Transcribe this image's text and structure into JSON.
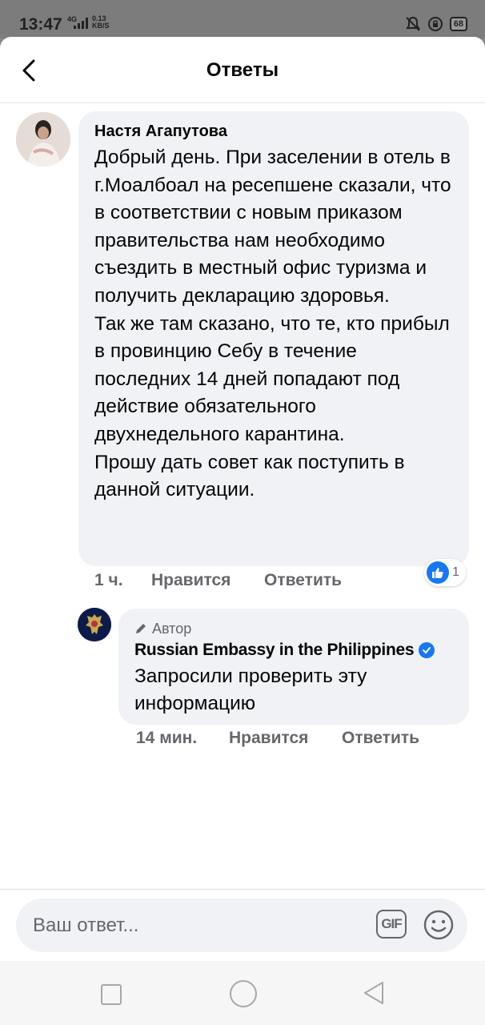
{
  "status_bar": {
    "time": "13:47",
    "network": "4G",
    "speed_value": "0.13",
    "speed_unit": "KB/S",
    "battery": "68"
  },
  "header": {
    "title": "Ответы"
  },
  "comment": {
    "author": "Настя Агапутова",
    "text": "Добрый день. При заселении в отель в г.Моалбоал на ресепшене сказали, что в соответствии с новым приказом правительства нам необходимо съездить в местный офис туризма и получить декларацию здоровья.\nТак же там сказано, что те, кто прибыл в провинцию Себу в течение последних 14 дней попадают под действие обязательного двухнедельного карантина.\nПрошу дать совет как поступить в данной ситуации.",
    "time": "1 ч.",
    "like_label": "Нравится",
    "reply_label": "Ответить",
    "reaction_count": "1"
  },
  "reply": {
    "author_tag": "Автор",
    "author": "Russian Embassy in the Philippines",
    "text": "Запросили проверить эту информацию",
    "time": "14 мин.",
    "like_label": "Нравится",
    "reply_label": "Ответить"
  },
  "composer": {
    "placeholder": "Ваш ответ...",
    "gif_label": "GIF"
  },
  "colors": {
    "accent": "#1877f2",
    "bubble": "#f0f2f5",
    "meta_text": "#65676b"
  }
}
